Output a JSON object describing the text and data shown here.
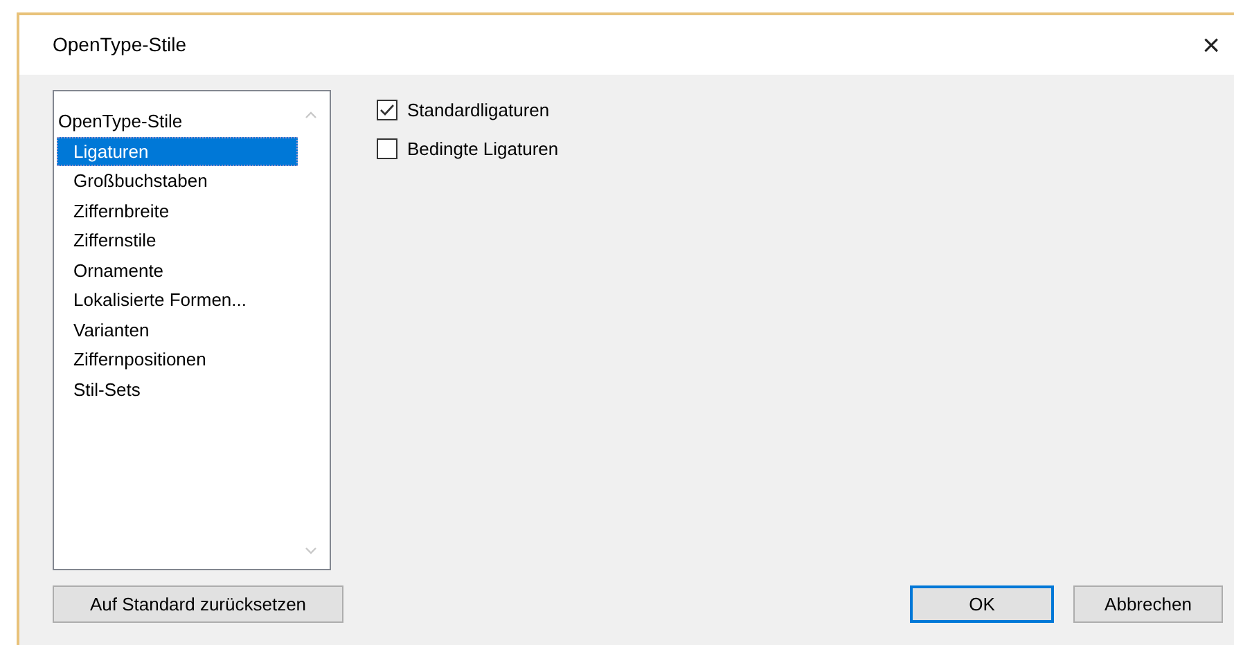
{
  "window": {
    "title": "OpenType-Stile",
    "close": "×"
  },
  "list": {
    "items": [
      {
        "label": "OpenType-Stile",
        "selected": false,
        "children": [
          {
            "label": "Ligaturen",
            "selected": true
          },
          {
            "label": "Großbuchstaben",
            "selected": false
          },
          {
            "label": "Ziffernbreite",
            "selected": false
          },
          {
            "label": "Ziffernstile",
            "selected": false
          },
          {
            "label": "Ornamente",
            "selected": false
          },
          {
            "label": "Lokalisierte Formen...",
            "selected": false
          },
          {
            "label": "Varianten",
            "selected": false
          },
          {
            "label": "Ziffernpositionen",
            "selected": false
          },
          {
            "label": "Stil-Sets",
            "selected": false
          }
        ]
      }
    ]
  },
  "options": [
    {
      "label": "Standardligaturen",
      "checked": true
    },
    {
      "label": "Bedingte Ligaturen",
      "checked": false
    }
  ],
  "buttons": {
    "reset": "Auf Standard zurücksetzen",
    "ok": "OK",
    "cancel": "Abbrechen"
  }
}
